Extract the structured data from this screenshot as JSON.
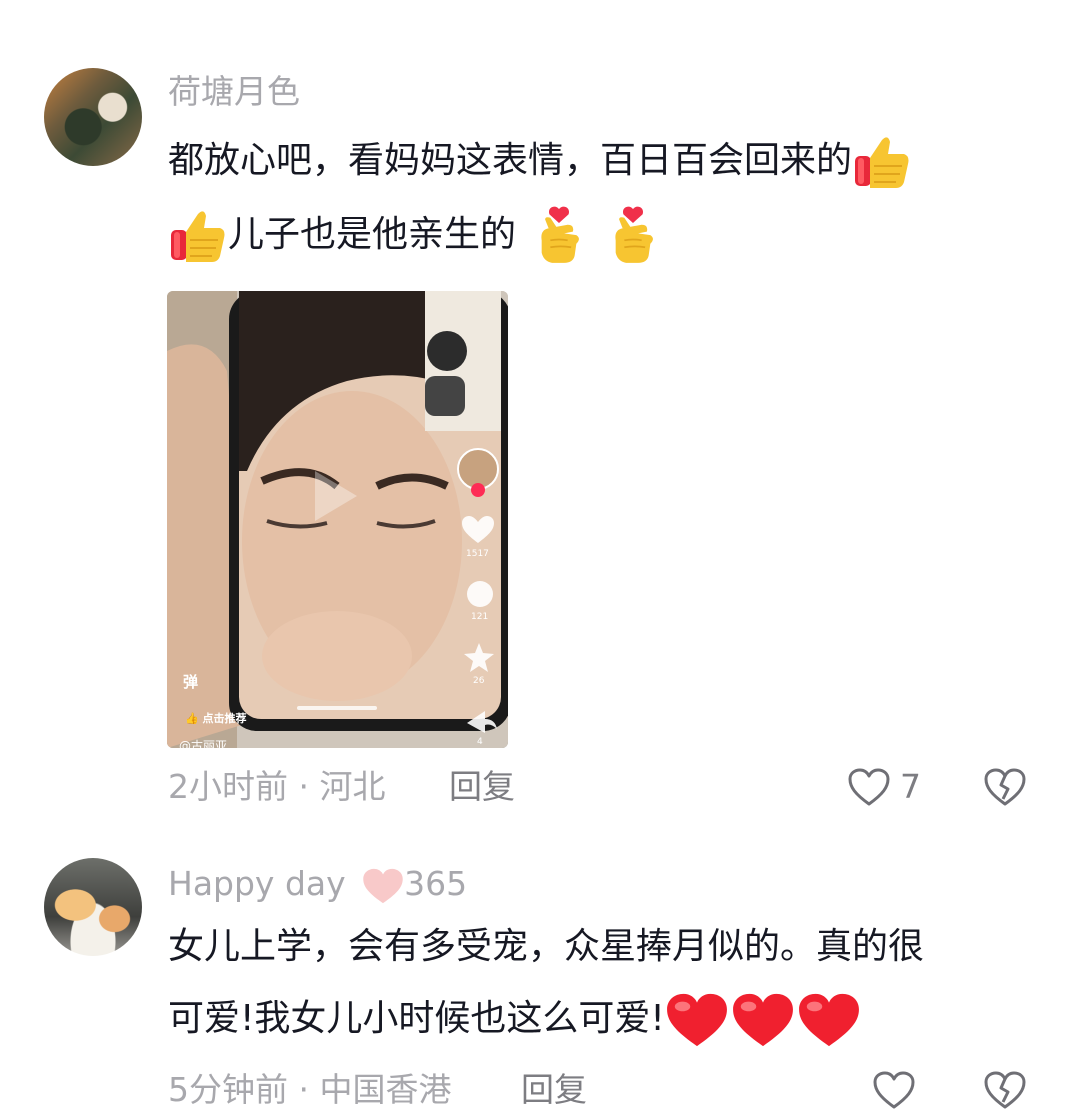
{
  "comments": [
    {
      "username": "荷塘月色",
      "text_line1": "都放心吧，看妈妈这表情，百日百会回来的",
      "text_line2": "儿子也是他亲生的",
      "meta": "2小时前 · 河北",
      "reply": "回复",
      "likes": "7",
      "media": {
        "overlay_danmaku": "弹",
        "overlay_recommend": "点击推荐",
        "overlay_author": "@古丽亚",
        "stat_like": "1517",
        "stat_comment": "121",
        "stat_star": "26",
        "stat_share": "4"
      }
    },
    {
      "username": "Happy day",
      "fan_level": "365",
      "text_line1": "女儿上学，会有多受宠，众星捧月似的。真的很",
      "text_line2": "可爱!我女儿小时候也这么可爱!",
      "meta": "5分钟前 · 中国香港",
      "reply": "回复"
    }
  ],
  "icons": {
    "thumbs_up": "thumbs-up-emoji",
    "finger_heart": "finger-heart-emoji",
    "red_heart": "red-heart-emoji",
    "like": "heart-outline-icon",
    "dislike": "broken-heart-icon"
  },
  "colors": {
    "meta_gray": "#a8a8ad",
    "text": "#161823",
    "emoji_yellow": "#f7c531",
    "heart_red": "#f0202f"
  }
}
